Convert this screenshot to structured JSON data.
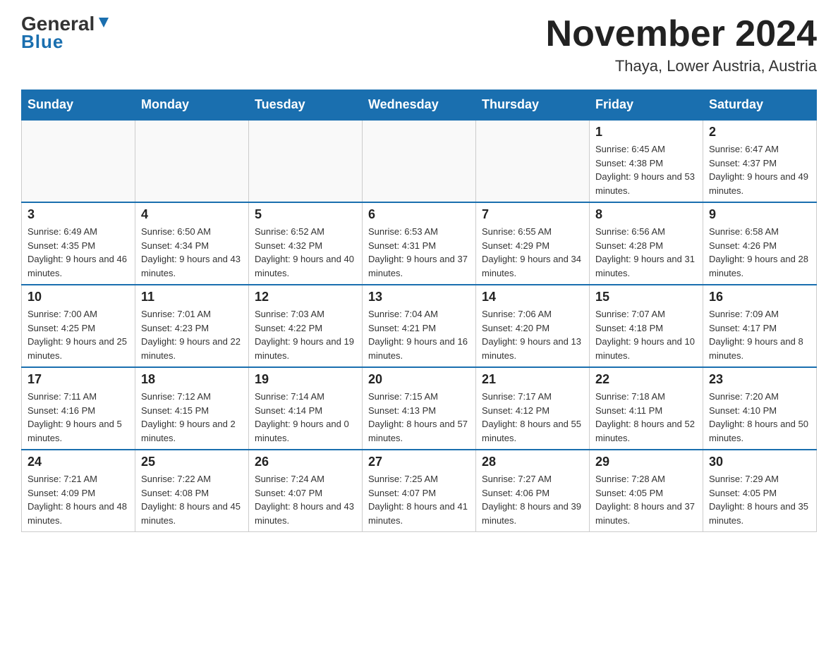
{
  "header": {
    "logo": {
      "text_general": "General",
      "text_blue": "Blue",
      "underline": "Blue"
    },
    "title": "November 2024",
    "location": "Thaya, Lower Austria, Austria"
  },
  "calendar": {
    "days_of_week": [
      "Sunday",
      "Monday",
      "Tuesday",
      "Wednesday",
      "Thursday",
      "Friday",
      "Saturday"
    ],
    "weeks": [
      {
        "days": [
          {
            "number": "",
            "info": ""
          },
          {
            "number": "",
            "info": ""
          },
          {
            "number": "",
            "info": ""
          },
          {
            "number": "",
            "info": ""
          },
          {
            "number": "",
            "info": ""
          },
          {
            "number": "1",
            "info": "Sunrise: 6:45 AM\nSunset: 4:38 PM\nDaylight: 9 hours and 53 minutes."
          },
          {
            "number": "2",
            "info": "Sunrise: 6:47 AM\nSunset: 4:37 PM\nDaylight: 9 hours and 49 minutes."
          }
        ]
      },
      {
        "days": [
          {
            "number": "3",
            "info": "Sunrise: 6:49 AM\nSunset: 4:35 PM\nDaylight: 9 hours and 46 minutes."
          },
          {
            "number": "4",
            "info": "Sunrise: 6:50 AM\nSunset: 4:34 PM\nDaylight: 9 hours and 43 minutes."
          },
          {
            "number": "5",
            "info": "Sunrise: 6:52 AM\nSunset: 4:32 PM\nDaylight: 9 hours and 40 minutes."
          },
          {
            "number": "6",
            "info": "Sunrise: 6:53 AM\nSunset: 4:31 PM\nDaylight: 9 hours and 37 minutes."
          },
          {
            "number": "7",
            "info": "Sunrise: 6:55 AM\nSunset: 4:29 PM\nDaylight: 9 hours and 34 minutes."
          },
          {
            "number": "8",
            "info": "Sunrise: 6:56 AM\nSunset: 4:28 PM\nDaylight: 9 hours and 31 minutes."
          },
          {
            "number": "9",
            "info": "Sunrise: 6:58 AM\nSunset: 4:26 PM\nDaylight: 9 hours and 28 minutes."
          }
        ]
      },
      {
        "days": [
          {
            "number": "10",
            "info": "Sunrise: 7:00 AM\nSunset: 4:25 PM\nDaylight: 9 hours and 25 minutes."
          },
          {
            "number": "11",
            "info": "Sunrise: 7:01 AM\nSunset: 4:23 PM\nDaylight: 9 hours and 22 minutes."
          },
          {
            "number": "12",
            "info": "Sunrise: 7:03 AM\nSunset: 4:22 PM\nDaylight: 9 hours and 19 minutes."
          },
          {
            "number": "13",
            "info": "Sunrise: 7:04 AM\nSunset: 4:21 PM\nDaylight: 9 hours and 16 minutes."
          },
          {
            "number": "14",
            "info": "Sunrise: 7:06 AM\nSunset: 4:20 PM\nDaylight: 9 hours and 13 minutes."
          },
          {
            "number": "15",
            "info": "Sunrise: 7:07 AM\nSunset: 4:18 PM\nDaylight: 9 hours and 10 minutes."
          },
          {
            "number": "16",
            "info": "Sunrise: 7:09 AM\nSunset: 4:17 PM\nDaylight: 9 hours and 8 minutes."
          }
        ]
      },
      {
        "days": [
          {
            "number": "17",
            "info": "Sunrise: 7:11 AM\nSunset: 4:16 PM\nDaylight: 9 hours and 5 minutes."
          },
          {
            "number": "18",
            "info": "Sunrise: 7:12 AM\nSunset: 4:15 PM\nDaylight: 9 hours and 2 minutes."
          },
          {
            "number": "19",
            "info": "Sunrise: 7:14 AM\nSunset: 4:14 PM\nDaylight: 9 hours and 0 minutes."
          },
          {
            "number": "20",
            "info": "Sunrise: 7:15 AM\nSunset: 4:13 PM\nDaylight: 8 hours and 57 minutes."
          },
          {
            "number": "21",
            "info": "Sunrise: 7:17 AM\nSunset: 4:12 PM\nDaylight: 8 hours and 55 minutes."
          },
          {
            "number": "22",
            "info": "Sunrise: 7:18 AM\nSunset: 4:11 PM\nDaylight: 8 hours and 52 minutes."
          },
          {
            "number": "23",
            "info": "Sunrise: 7:20 AM\nSunset: 4:10 PM\nDaylight: 8 hours and 50 minutes."
          }
        ]
      },
      {
        "days": [
          {
            "number": "24",
            "info": "Sunrise: 7:21 AM\nSunset: 4:09 PM\nDaylight: 8 hours and 48 minutes."
          },
          {
            "number": "25",
            "info": "Sunrise: 7:22 AM\nSunset: 4:08 PM\nDaylight: 8 hours and 45 minutes."
          },
          {
            "number": "26",
            "info": "Sunrise: 7:24 AM\nSunset: 4:07 PM\nDaylight: 8 hours and 43 minutes."
          },
          {
            "number": "27",
            "info": "Sunrise: 7:25 AM\nSunset: 4:07 PM\nDaylight: 8 hours and 41 minutes."
          },
          {
            "number": "28",
            "info": "Sunrise: 7:27 AM\nSunset: 4:06 PM\nDaylight: 8 hours and 39 minutes."
          },
          {
            "number": "29",
            "info": "Sunrise: 7:28 AM\nSunset: 4:05 PM\nDaylight: 8 hours and 37 minutes."
          },
          {
            "number": "30",
            "info": "Sunrise: 7:29 AM\nSunset: 4:05 PM\nDaylight: 8 hours and 35 minutes."
          }
        ]
      }
    ]
  }
}
